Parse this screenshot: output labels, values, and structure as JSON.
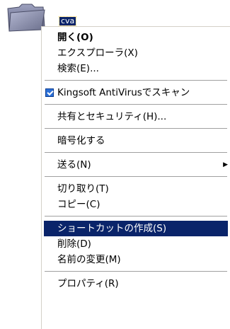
{
  "folder": {
    "name": "cva",
    "icon": "folder-icon"
  },
  "menu": {
    "items": [
      {
        "label": "開く(O)",
        "bold": true
      },
      {
        "label": "エクスプローラ(X)"
      },
      {
        "label": "検索(E)..."
      },
      {
        "separator": true
      },
      {
        "label": "Kingsoft AntiVirusでスキャン",
        "icon": "kingsoft-antivirus-icon"
      },
      {
        "separator": true
      },
      {
        "label": "共有とセキュリティ(H)..."
      },
      {
        "separator": true
      },
      {
        "label": "暗号化する"
      },
      {
        "separator": true
      },
      {
        "label": "送る(N)",
        "submenu": true
      },
      {
        "separator": true
      },
      {
        "label": "切り取り(T)"
      },
      {
        "label": "コピー(C)"
      },
      {
        "separator": true
      },
      {
        "label": "ショートカットの作成(S)",
        "highlighted": true
      },
      {
        "label": "削除(D)"
      },
      {
        "label": "名前の変更(M)"
      },
      {
        "separator": true
      },
      {
        "label": "プロパティ(R)"
      }
    ]
  },
  "colors": {
    "highlight_bg": "#0a246a",
    "highlight_text": "#ffffff",
    "menu_bg": "#ffffff",
    "folder_color": "#7a7ea0"
  }
}
